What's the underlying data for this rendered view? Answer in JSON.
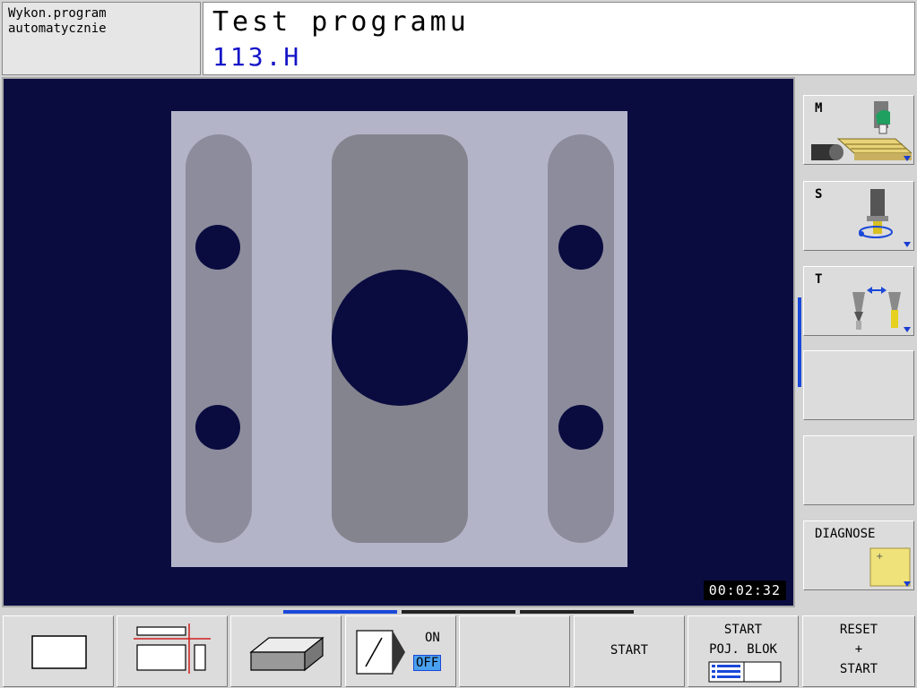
{
  "header": {
    "mode_line1": "Wykon.program",
    "mode_line2": "automatycznie",
    "title": "Test programu",
    "file": "113.H"
  },
  "graphics": {
    "timer": "00:02:32"
  },
  "side_softkeys": [
    {
      "label": "M",
      "icon": "machine-table-icon"
    },
    {
      "label": "S",
      "icon": "spindle-icon"
    },
    {
      "label": "T",
      "icon": "tool-change-icon"
    },
    {
      "label": "",
      "icon": ""
    },
    {
      "label": "",
      "icon": ""
    },
    {
      "label": "DIAGNOSE",
      "icon": "diagnose-note-icon"
    }
  ],
  "bottom_softkeys": {
    "view_plan": "plan-view-icon",
    "view_three_planes": "three-planes-icon",
    "view_3d": "3d-block-icon",
    "block_skip": {
      "on": "ON",
      "off": "OFF"
    },
    "start": "START",
    "start_single_line1": "START",
    "start_single_line2": "POJ. BLOK",
    "reset_line1": "RESET",
    "reset_line2": "+",
    "reset_line3": "START"
  },
  "colors": {
    "viewport_bg": "#0a0c40",
    "blank": "#b4b4c8",
    "pocket": "#8c8c9c",
    "deep_pocket": "#84848e",
    "accent": "#1a48d8"
  }
}
